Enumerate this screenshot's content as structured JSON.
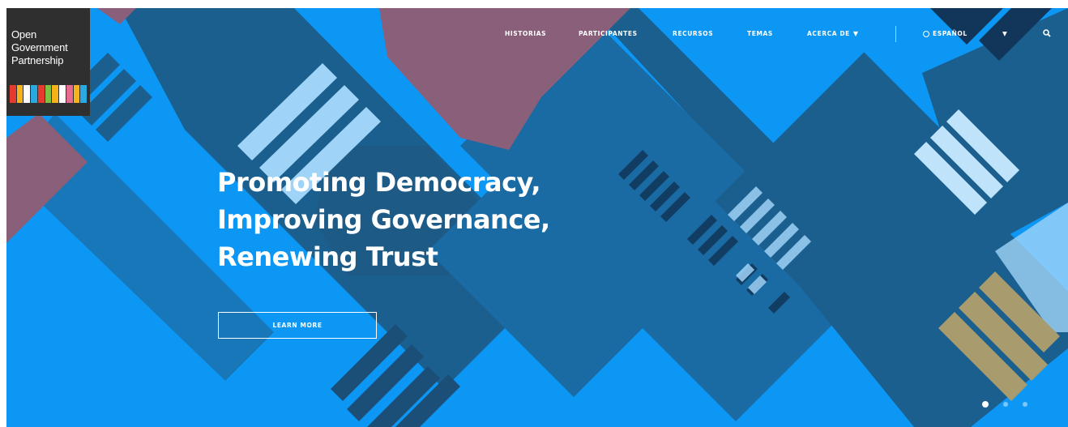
{
  "logo": {
    "line1": "Open",
    "line2": "Government",
    "line3": "Partnership",
    "stripe_colors": [
      "#e73a2f",
      "#f6b21b",
      "#ffffff",
      "#2aa8e0",
      "#e73a2f",
      "#7cc143",
      "#f6b21b",
      "#ffffff",
      "#e86a8f",
      "#f6b21b",
      "#2aa8e0"
    ]
  },
  "nav": {
    "items": [
      "HISTORIAS",
      "PARTICIPANTES",
      "RECURSOS",
      "TEMAS",
      "ACERCA DE"
    ],
    "language": "ESPAÑOL",
    "caret": "▼"
  },
  "hero": {
    "headline_line1": "Promoting Democracy,",
    "headline_line2": "Improving Governance,",
    "headline_line3": "Renewing Trust",
    "cta_label": "LEARN MORE",
    "slide_count": 3,
    "active_slide": 1
  },
  "colors": {
    "background": "#0d97f5",
    "dark_blue": "#1b5f8e",
    "mauve": "#8a5f7a",
    "light_blue": "#9fd3f7",
    "khaki": "#a89b6e",
    "navy": "#12355a"
  },
  "icons": [
    "globe-icon",
    "search-icon",
    "chevron-down-icon"
  ]
}
